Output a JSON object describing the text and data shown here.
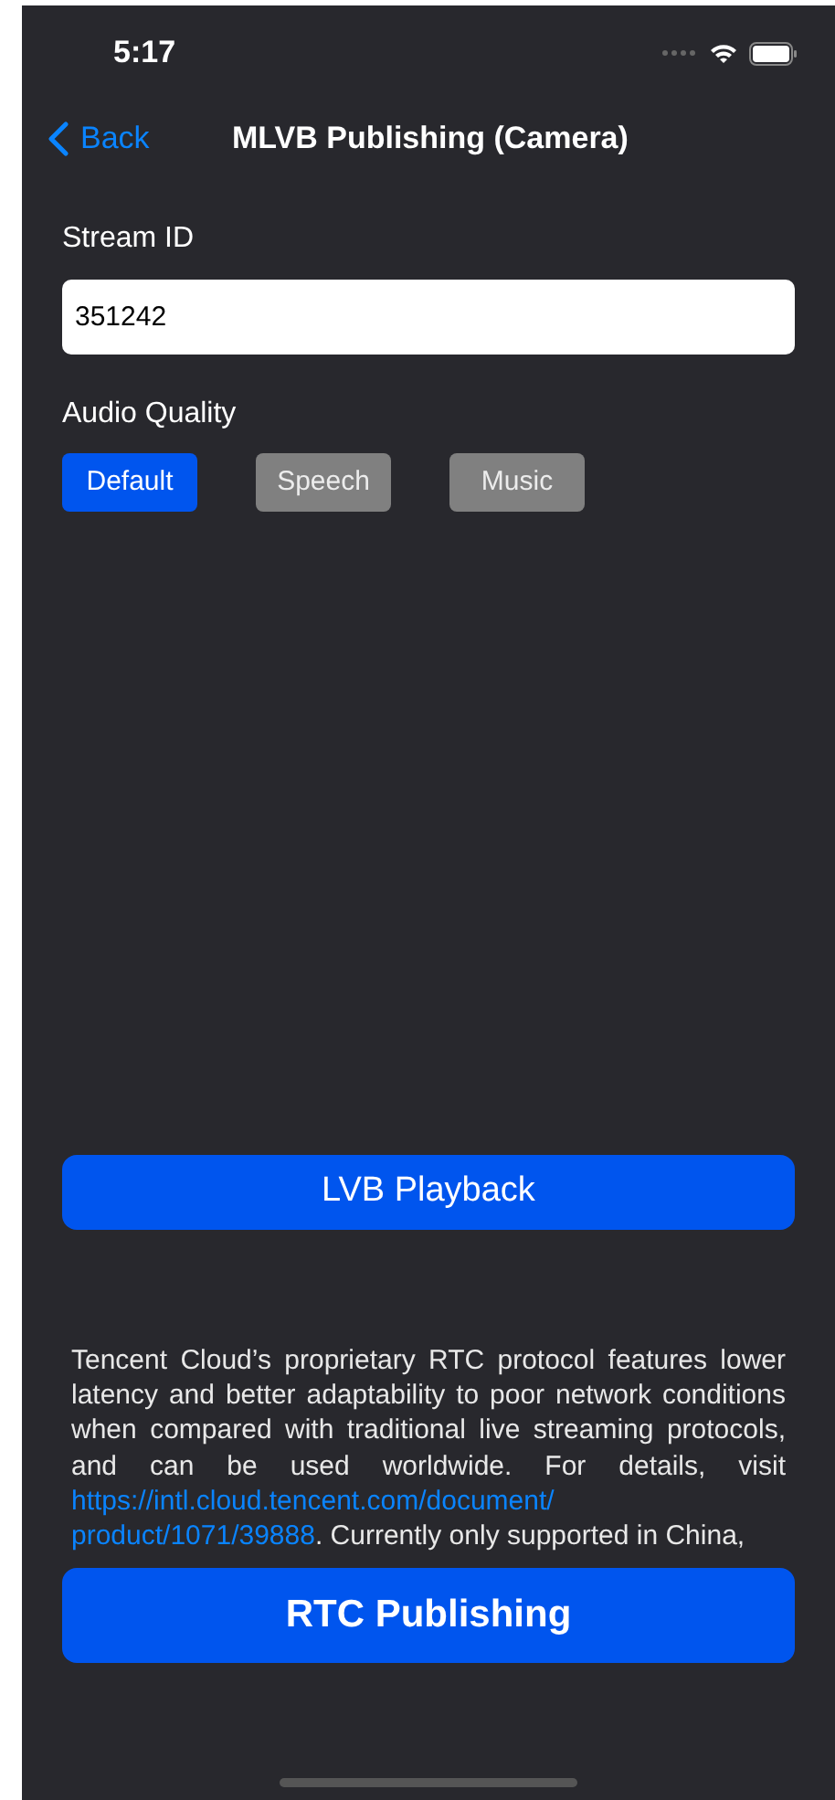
{
  "status_bar": {
    "time": "5:17"
  },
  "nav": {
    "back": "Back",
    "title": "MLVB Publishing (Camera)"
  },
  "stream_id": {
    "label": "Stream ID",
    "value": "351242"
  },
  "audio_quality": {
    "label": "Audio Quality",
    "options": [
      {
        "label": "Default",
        "selected": true
      },
      {
        "label": "Speech",
        "selected": false
      },
      {
        "label": "Music",
        "selected": false
      }
    ]
  },
  "playback_button": "LVB Playback",
  "description": [
    {
      "kind": "text",
      "text": "Tencent Cloud’s proprietary RTC protocol features lower latency and better adaptability to poor network conditions when compared with traditional live streaming protocols, and can be used worldwide. For details, visit"
    },
    {
      "kind": "link",
      "text": "https://intl.cloud.tencent.com/document/"
    },
    {
      "kind": "link",
      "text": "product/1071/39888"
    },
    {
      "kind": "text",
      "text": ". Currently only supported in China,"
    }
  ],
  "publish_button": "RTC Publishing"
}
